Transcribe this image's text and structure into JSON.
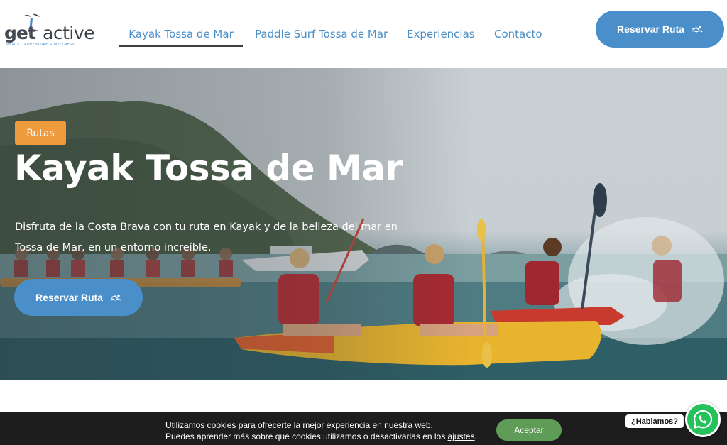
{
  "brand": {
    "logo_primary": "get",
    "logo_secondary": "active",
    "logo_left_sub": "SPORTS",
    "logo_tagline": "ADVENTURE & WELLNESS",
    "accent_color": "#4a8fc9",
    "badge_color": "#ee9b3d",
    "accept_color": "#5f9c57",
    "whatsapp_color": "#25c15b"
  },
  "nav": {
    "items": [
      {
        "label": "Kayak Tossa de Mar",
        "active": true
      },
      {
        "label": "Paddle Surf Tossa de Mar",
        "active": false
      },
      {
        "label": "Experiencias",
        "active": false
      },
      {
        "label": "Contacto",
        "active": false
      }
    ],
    "cta_label": "Reservar Ruta",
    "cta_icon": "swimmer-icon"
  },
  "hero": {
    "badge": "Rutas",
    "title": "Kayak Tossa de Mar",
    "description": "Disfruta de la Costa Brava con tu ruta en Kayak y de la belleza del mar en Tossa de Mar, en un entorno increíble.",
    "cta_label": "Reservar Ruta",
    "cta_icon": "swimmer-icon"
  },
  "cookie": {
    "line1": "Utilizamos cookies para ofrecerte la mejor experiencia en nuestra web.",
    "line2_prefix": "Puedes aprender más sobre qué cookies utilizamos o desactivarlas en los ",
    "line2_link": "ajustes",
    "line2_suffix": ".",
    "accept_label": "Aceptar"
  },
  "chat": {
    "label": "¿Hablamos?",
    "icon": "whatsapp-icon"
  }
}
